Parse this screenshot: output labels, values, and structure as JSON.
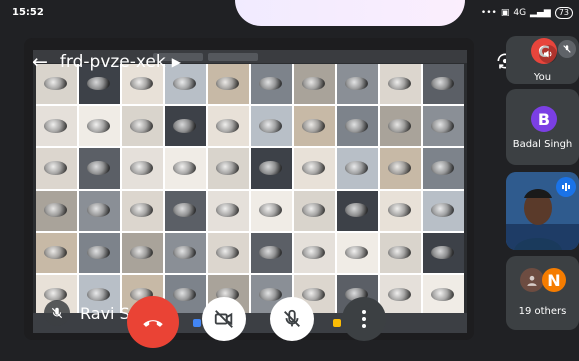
{
  "status": {
    "time": "15:52",
    "network": "4G",
    "battery": "73"
  },
  "meeting": {
    "code": "frd-pvze-xek"
  },
  "presenter": {
    "name": "Ravi Sv"
  },
  "participants": {
    "you": {
      "label": "You",
      "initial": "C",
      "avatar_color": "#e8453c"
    },
    "badal": {
      "name": "Badal Singh",
      "initial": "B",
      "avatar_color": "#7b3fe4"
    },
    "others": {
      "label": "19 others",
      "initial": "N",
      "avatar_color": "#f57c00"
    }
  },
  "controls": {
    "end_call_icon": "phone-hangup-icon",
    "camera_icon": "camera-off-icon",
    "mic_icon": "mic-off-icon",
    "more_icon": "more-vert-icon"
  },
  "colors": {
    "end_call": "#ea4335",
    "tile_bg": "#3c4043",
    "background": "#202124"
  }
}
